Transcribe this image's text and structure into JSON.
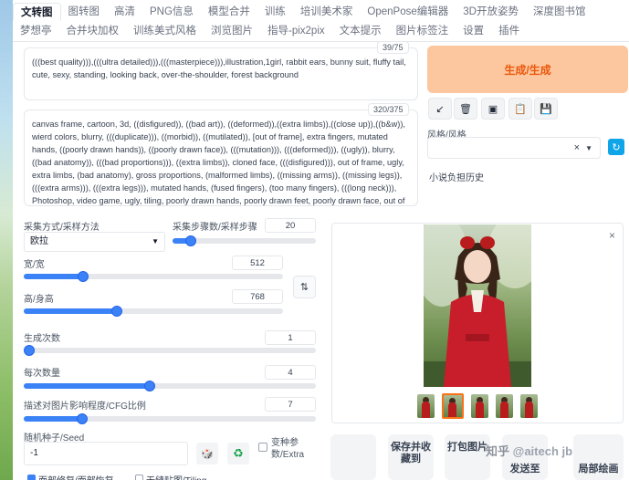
{
  "tabs": {
    "row1": [
      "文转图",
      "图转图",
      "高清",
      "PNG信息",
      "模型合并",
      "训练",
      "培训美术家",
      "OpenPose编辑器",
      "3D开放姿势",
      "深度图书馆"
    ],
    "row2": [
      "梦想亭",
      "合并块加权",
      "训练美式风格",
      "浏览图片",
      "指导-pix2pix",
      "文本提示",
      "图片标签注",
      "设置",
      "插件"
    ],
    "active": "文转图"
  },
  "prompt": {
    "positive": "(((best quality))),(((ultra detailed))),(((masterpiece))),illustration,1girl, rabbit ears, bunny suit, fluffy tail, cute, sexy, standing, looking back, over-the-shoulder, forest background",
    "positive_counter": "39/75",
    "negative": "canvas frame, cartoon, 3d, ((disfigured)), ((bad art)), ((deformed)),((extra limbs)),((close up)),((b&w)), wierd colors, blurry, (((duplicate))), ((morbid)), ((mutilated)), [out of frame], extra fingers, mutated hands, ((poorly drawn hands)), ((poorly drawn face)), (((mutation))), (((deformed))), ((ugly)), blurry, ((bad anatomy)), (((bad proportions))), ((extra limbs)), cloned face, (((disfigured))), out of frame, ugly, extra limbs, (bad anatomy), gross proportions, (malformed limbs), ((missing arms)), ((missing legs)), (((extra arms))), (((extra legs))), mutated hands, (fused fingers), (too many fingers), (((long neck))), Photoshop, video game, ugly, tiling, poorly drawn hands, poorly drawn feet, poorly drawn face, out of frame, mutation, mutated, extra limbs, extra legs, disfigured, deformed, cross-eye, body out of",
    "negative_counter": "320/375"
  },
  "generate": {
    "label": "生成/生成"
  },
  "tools": {
    "icons": [
      "arrow-icon",
      "trash-icon",
      "card-icon",
      "clipboard-icon",
      "save-icon"
    ],
    "glyphs": [
      "↙",
      "🗑",
      "▣",
      "📋",
      "💾"
    ]
  },
  "styles": {
    "label": "风格/风格",
    "clear": "×",
    "refresh": "↻"
  },
  "history_label": "小说负担历史",
  "sampler": {
    "label": "采集方式/采样方法",
    "value": "欧拉"
  },
  "steps": {
    "label": "采集步骤数/采样步骤",
    "value": "20",
    "fraction": 0.13
  },
  "width": {
    "label": "宽/宽",
    "value": "512",
    "fraction": 0.23
  },
  "height": {
    "label": "高/身高",
    "value": "768",
    "fraction": 0.36
  },
  "swap_glyph": "⇅",
  "batch_count": {
    "label": "生成次数",
    "value": "1",
    "fraction": 0.0
  },
  "batch_size": {
    "label": "每次数量",
    "value": "4",
    "fraction": 0.43
  },
  "cfg": {
    "label": "描述对图片影响程度/CFG比例",
    "value": "7",
    "fraction": 0.2
  },
  "seed": {
    "label": "随机种子/Seed",
    "value": "-1",
    "dice": "🎲",
    "recycle": "♻"
  },
  "extra": {
    "label": "变种参数/Extra"
  },
  "bottom_options": [
    "面部修复/面部恢复",
    "无缝贴图/Tiling"
  ],
  "gallery": {
    "close": "×",
    "thumb_count": 5,
    "selected": 1
  },
  "actions": [
    "保存并收藏到",
    "打包图片",
    "发送至",
    "局部绘画"
  ],
  "watermark": {
    "zh": "知乎",
    "handle": "@aitech jb"
  },
  "colors": {
    "accent": "#3b82f6",
    "generate_bg": "#fcc79f",
    "generate_text": "#ea580c",
    "selected_thumb": "#f97316"
  }
}
